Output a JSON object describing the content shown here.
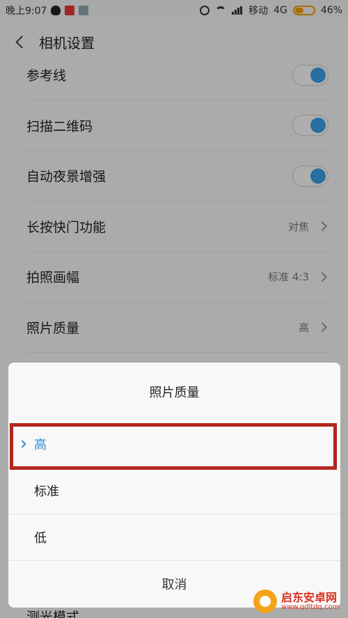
{
  "status_bar": {
    "time": "晚上9:07",
    "carrier": "移动",
    "network": "4G",
    "battery": "46%",
    "battery_level": 0.46
  },
  "header": {
    "title": "相机设置"
  },
  "settings": [
    {
      "label": "参考线",
      "type": "toggle",
      "on": true
    },
    {
      "label": "扫描二维码",
      "type": "toggle",
      "on": true
    },
    {
      "label": "自动夜景增强",
      "type": "toggle",
      "on": true
    },
    {
      "label": "长按快门功能",
      "type": "value",
      "value": "对焦"
    },
    {
      "label": "拍照画幅",
      "type": "value",
      "value": "标准 4:3"
    },
    {
      "label": "照片质量",
      "type": "value",
      "value": "高"
    }
  ],
  "bottom_partial_row": "测光模式",
  "dialog": {
    "title": "照片质量",
    "options": [
      {
        "label": "高",
        "selected": true
      },
      {
        "label": "标准",
        "selected": false
      },
      {
        "label": "低",
        "selected": false
      }
    ],
    "cancel": "取消"
  },
  "watermark": {
    "title": "启东安卓网",
    "url": "www.qdltdq.com"
  },
  "colors": {
    "accent": "#2f8fd6",
    "toggle_on": "#3aa0e6",
    "highlight_border": "#b3261e"
  }
}
